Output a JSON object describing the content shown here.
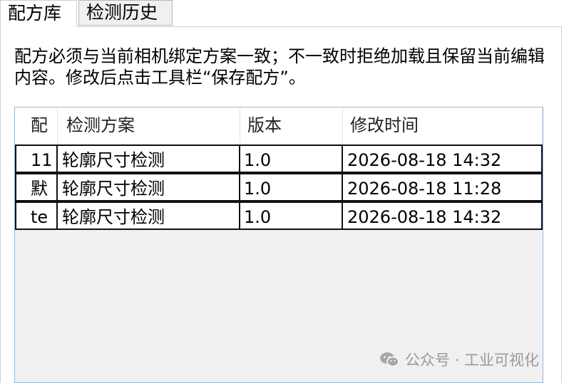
{
  "tabs": [
    {
      "label": "配方库",
      "active": true
    },
    {
      "label": "检测历史",
      "active": false
    }
  ],
  "description": "配方必须与当前相机绑定方案一致；不一致时拒绝加载且保留当前编辑内容。修改后点击工具栏“保存配方”。",
  "table": {
    "columns": [
      "配",
      "检测方案",
      "版本",
      "修改时间"
    ],
    "rows": [
      {
        "name": "11",
        "scheme": "轮廓尺寸检测",
        "version": "1.0",
        "modified": "2026-08-18 14:32"
      },
      {
        "name": "默",
        "scheme": "轮廓尺寸检测",
        "version": "1.0",
        "modified": "2026-08-18 11:28"
      },
      {
        "name": "te",
        "scheme": "轮廓尺寸检测",
        "version": "1.0",
        "modified": "2026-08-18 14:32"
      }
    ]
  },
  "watermark": {
    "text": "公众号 · 工业可视化",
    "icon": "wechat-icon"
  }
}
